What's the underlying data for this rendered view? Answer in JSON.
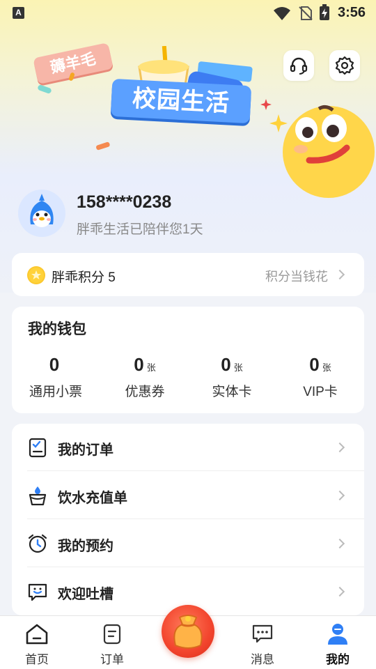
{
  "status_bar": {
    "time": "3:56",
    "badge": "A"
  },
  "banner": {
    "tag_small": "薅羊毛",
    "tag_large": "校园生活"
  },
  "profile": {
    "phone": "158****0238",
    "since": "胖乖生活已陪伴您1天"
  },
  "points": {
    "label": "胖乖积分 5",
    "hint": "积分当钱花"
  },
  "wallet": {
    "title": "我的钱包",
    "items": [
      {
        "value": "0",
        "unit": "",
        "label": "通用小票"
      },
      {
        "value": "0",
        "unit": "张",
        "label": "优惠券"
      },
      {
        "value": "0",
        "unit": "张",
        "label": "实体卡"
      },
      {
        "value": "0",
        "unit": "张",
        "label": "VIP卡"
      }
    ]
  },
  "menu": [
    {
      "label": "我的订单",
      "icon": "order-list-icon"
    },
    {
      "label": "饮水充值单",
      "icon": "water-cup-icon"
    },
    {
      "label": "我的预约",
      "icon": "alarm-clock-icon"
    },
    {
      "label": "欢迎吐槽",
      "icon": "feedback-chat-icon"
    }
  ],
  "nav": {
    "home": "首页",
    "orders": "订单",
    "messages": "消息",
    "mine": "我的"
  },
  "colors": {
    "accent": "#2f7ff5",
    "brand_red": "#f2442d",
    "banner_blue": "#5ba0ff"
  }
}
